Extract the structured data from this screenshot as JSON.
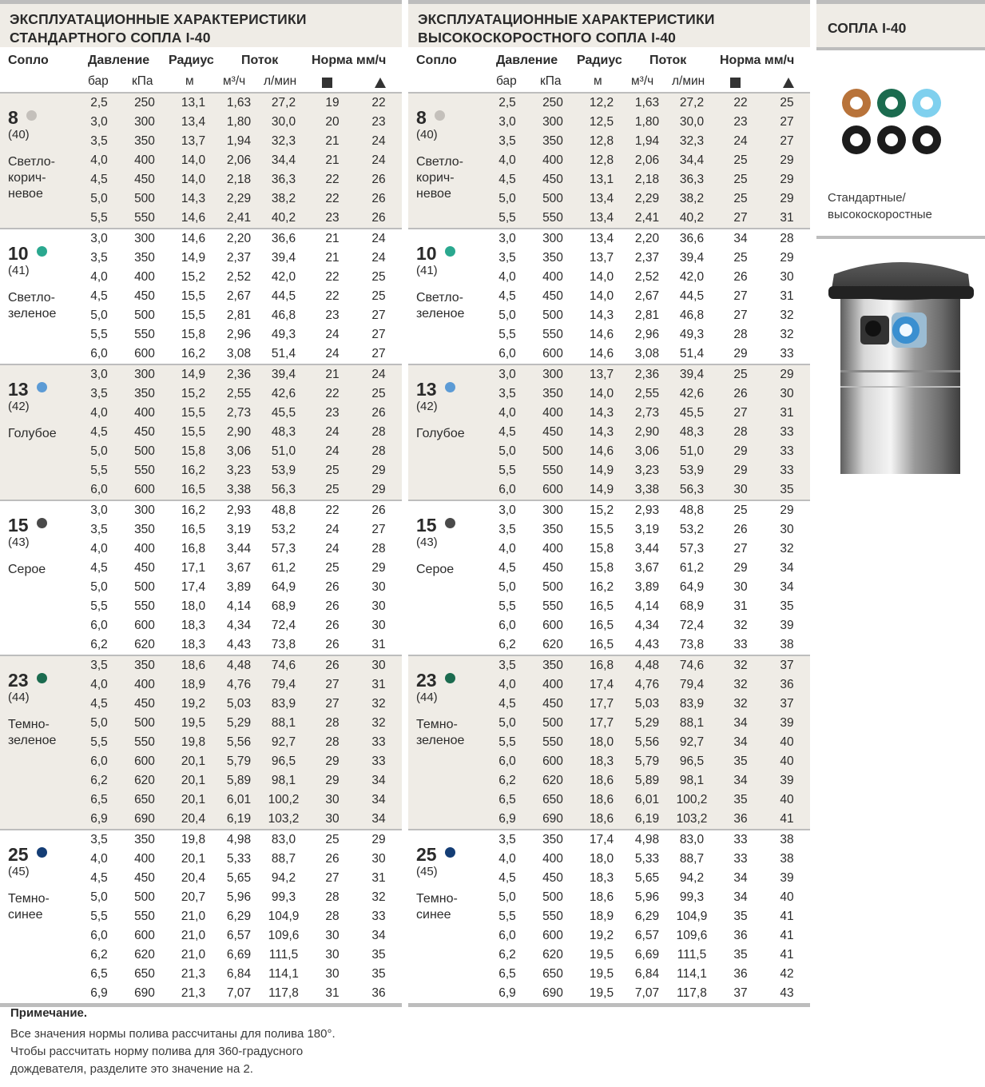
{
  "std": {
    "title_l1": "ЭКСПЛУАТАЦИОННЫЕ ХАРАКТЕРИСТИКИ",
    "title_l2": "СТАНДАРТНОГО СОПЛА I-40",
    "groups": [
      {
        "num": "8",
        "code": "(40)",
        "name1": "Светло-",
        "name2": "корич-",
        "name3": "невое",
        "color": "#c4c0bb",
        "rows": [
          [
            "2,5",
            "250",
            "13,1",
            "1,63",
            "27,2",
            "19",
            "22"
          ],
          [
            "3,0",
            "300",
            "13,4",
            "1,80",
            "30,0",
            "20",
            "23"
          ],
          [
            "3,5",
            "350",
            "13,7",
            "1,94",
            "32,3",
            "21",
            "24"
          ],
          [
            "4,0",
            "400",
            "14,0",
            "2,06",
            "34,4",
            "21",
            "24"
          ],
          [
            "4,5",
            "450",
            "14,0",
            "2,18",
            "36,3",
            "22",
            "26"
          ],
          [
            "5,0",
            "500",
            "14,3",
            "2,29",
            "38,2",
            "22",
            "26"
          ],
          [
            "5,5",
            "550",
            "14,6",
            "2,41",
            "40,2",
            "23",
            "26"
          ]
        ]
      },
      {
        "num": "10",
        "code": "(41)",
        "name1": "Светло-",
        "name2": "зеленое",
        "name3": "",
        "color": "#2aa88f",
        "rows": [
          [
            "3,0",
            "300",
            "14,6",
            "2,20",
            "36,6",
            "21",
            "24"
          ],
          [
            "3,5",
            "350",
            "14,9",
            "2,37",
            "39,4",
            "21",
            "24"
          ],
          [
            "4,0",
            "400",
            "15,2",
            "2,52",
            "42,0",
            "22",
            "25"
          ],
          [
            "4,5",
            "450",
            "15,5",
            "2,67",
            "44,5",
            "22",
            "25"
          ],
          [
            "5,0",
            "500",
            "15,5",
            "2,81",
            "46,8",
            "23",
            "27"
          ],
          [
            "5,5",
            "550",
            "15,8",
            "2,96",
            "49,3",
            "24",
            "27"
          ],
          [
            "6,0",
            "600",
            "16,2",
            "3,08",
            "51,4",
            "24",
            "27"
          ]
        ]
      },
      {
        "num": "13",
        "code": "(42)",
        "name1": "Голубое",
        "name2": "",
        "name3": "",
        "color": "#5c9bd5",
        "rows": [
          [
            "3,0",
            "300",
            "14,9",
            "2,36",
            "39,4",
            "21",
            "24"
          ],
          [
            "3,5",
            "350",
            "15,2",
            "2,55",
            "42,6",
            "22",
            "25"
          ],
          [
            "4,0",
            "400",
            "15,5",
            "2,73",
            "45,5",
            "23",
            "26"
          ],
          [
            "4,5",
            "450",
            "15,5",
            "2,90",
            "48,3",
            "24",
            "28"
          ],
          [
            "5,0",
            "500",
            "15,8",
            "3,06",
            "51,0",
            "24",
            "28"
          ],
          [
            "5,5",
            "550",
            "16,2",
            "3,23",
            "53,9",
            "25",
            "29"
          ],
          [
            "6,0",
            "600",
            "16,5",
            "3,38",
            "56,3",
            "25",
            "29"
          ]
        ]
      },
      {
        "num": "15",
        "code": "(43)",
        "name1": "Серое",
        "name2": "",
        "name3": "",
        "color": "#4a4a4a",
        "rows": [
          [
            "3,0",
            "300",
            "16,2",
            "2,93",
            "48,8",
            "22",
            "26"
          ],
          [
            "3,5",
            "350",
            "16,5",
            "3,19",
            "53,2",
            "24",
            "27"
          ],
          [
            "4,0",
            "400",
            "16,8",
            "3,44",
            "57,3",
            "24",
            "28"
          ],
          [
            "4,5",
            "450",
            "17,1",
            "3,67",
            "61,2",
            "25",
            "29"
          ],
          [
            "5,0",
            "500",
            "17,4",
            "3,89",
            "64,9",
            "26",
            "30"
          ],
          [
            "5,5",
            "550",
            "18,0",
            "4,14",
            "68,9",
            "26",
            "30"
          ],
          [
            "6,0",
            "600",
            "18,3",
            "4,34",
            "72,4",
            "26",
            "30"
          ],
          [
            "6,2",
            "620",
            "18,3",
            "4,43",
            "73,8",
            "26",
            "31"
          ]
        ]
      },
      {
        "num": "23",
        "code": "(44)",
        "name1": "Темно-",
        "name2": "зеленое",
        "name3": "",
        "color": "#1b6b4f",
        "rows": [
          [
            "3,5",
            "350",
            "18,6",
            "4,48",
            "74,6",
            "26",
            "30"
          ],
          [
            "4,0",
            "400",
            "18,9",
            "4,76",
            "79,4",
            "27",
            "31"
          ],
          [
            "4,5",
            "450",
            "19,2",
            "5,03",
            "83,9",
            "27",
            "32"
          ],
          [
            "5,0",
            "500",
            "19,5",
            "5,29",
            "88,1",
            "28",
            "32"
          ],
          [
            "5,5",
            "550",
            "19,8",
            "5,56",
            "92,7",
            "28",
            "33"
          ],
          [
            "6,0",
            "600",
            "20,1",
            "5,79",
            "96,5",
            "29",
            "33"
          ],
          [
            "6,2",
            "620",
            "20,1",
            "5,89",
            "98,1",
            "29",
            "34"
          ],
          [
            "6,5",
            "650",
            "20,1",
            "6,01",
            "100,2",
            "30",
            "34"
          ],
          [
            "6,9",
            "690",
            "20,4",
            "6,19",
            "103,2",
            "30",
            "34"
          ]
        ]
      },
      {
        "num": "25",
        "code": "(45)",
        "name1": "Темно-",
        "name2": "синее",
        "name3": "",
        "color": "#143d75",
        "rows": [
          [
            "3,5",
            "350",
            "19,8",
            "4,98",
            "83,0",
            "25",
            "29"
          ],
          [
            "4,0",
            "400",
            "20,1",
            "5,33",
            "88,7",
            "26",
            "30"
          ],
          [
            "4,5",
            "450",
            "20,4",
            "5,65",
            "94,2",
            "27",
            "31"
          ],
          [
            "5,0",
            "500",
            "20,7",
            "5,96",
            "99,3",
            "28",
            "32"
          ],
          [
            "5,5",
            "550",
            "21,0",
            "6,29",
            "104,9",
            "28",
            "33"
          ],
          [
            "6,0",
            "600",
            "21,0",
            "6,57",
            "109,6",
            "30",
            "34"
          ],
          [
            "6,2",
            "620",
            "21,0",
            "6,69",
            "111,5",
            "30",
            "35"
          ],
          [
            "6,5",
            "650",
            "21,3",
            "6,84",
            "114,1",
            "30",
            "35"
          ],
          [
            "6,9",
            "690",
            "21,3",
            "7,07",
            "117,8",
            "31",
            "36"
          ]
        ]
      }
    ]
  },
  "hs": {
    "title_l1": "ЭКСПЛУАТАЦИОННЫЕ ХАРАКТЕРИСТИКИ",
    "title_l2": "ВЫСОКОСКОРОСТНОГО СОПЛА I-40",
    "groups": [
      {
        "num": "8",
        "code": "(40)",
        "name1": "Светло-",
        "name2": "корич-",
        "name3": "невое",
        "color": "#c4c0bb",
        "rows": [
          [
            "2,5",
            "250",
            "12,2",
            "1,63",
            "27,2",
            "22",
            "25"
          ],
          [
            "3,0",
            "300",
            "12,5",
            "1,80",
            "30,0",
            "23",
            "27"
          ],
          [
            "3,5",
            "350",
            "12,8",
            "1,94",
            "32,3",
            "24",
            "27"
          ],
          [
            "4,0",
            "400",
            "12,8",
            "2,06",
            "34,4",
            "25",
            "29"
          ],
          [
            "4,5",
            "450",
            "13,1",
            "2,18",
            "36,3",
            "25",
            "29"
          ],
          [
            "5,0",
            "500",
            "13,4",
            "2,29",
            "38,2",
            "25",
            "29"
          ],
          [
            "5,5",
            "550",
            "13,4",
            "2,41",
            "40,2",
            "27",
            "31"
          ]
        ]
      },
      {
        "num": "10",
        "code": "(41)",
        "name1": "Светло-",
        "name2": "зеленое",
        "name3": "",
        "color": "#2aa88f",
        "rows": [
          [
            "3,0",
            "300",
            "13,4",
            "2,20",
            "36,6",
            "34",
            "28"
          ],
          [
            "3,5",
            "350",
            "13,7",
            "2,37",
            "39,4",
            "25",
            "29"
          ],
          [
            "4,0",
            "400",
            "14,0",
            "2,52",
            "42,0",
            "26",
            "30"
          ],
          [
            "4,5",
            "450",
            "14,0",
            "2,67",
            "44,5",
            "27",
            "31"
          ],
          [
            "5,0",
            "500",
            "14,3",
            "2,81",
            "46,8",
            "27",
            "32"
          ],
          [
            "5,5",
            "550",
            "14,6",
            "2,96",
            "49,3",
            "28",
            "32"
          ],
          [
            "6,0",
            "600",
            "14,6",
            "3,08",
            "51,4",
            "29",
            "33"
          ]
        ]
      },
      {
        "num": "13",
        "code": "(42)",
        "name1": "Голубое",
        "name2": "",
        "name3": "",
        "color": "#5c9bd5",
        "rows": [
          [
            "3,0",
            "300",
            "13,7",
            "2,36",
            "39,4",
            "25",
            "29"
          ],
          [
            "3,5",
            "350",
            "14,0",
            "2,55",
            "42,6",
            "26",
            "30"
          ],
          [
            "4,0",
            "400",
            "14,3",
            "2,73",
            "45,5",
            "27",
            "31"
          ],
          [
            "4,5",
            "450",
            "14,3",
            "2,90",
            "48,3",
            "28",
            "33"
          ],
          [
            "5,0",
            "500",
            "14,6",
            "3,06",
            "51,0",
            "29",
            "33"
          ],
          [
            "5,5",
            "550",
            "14,9",
            "3,23",
            "53,9",
            "29",
            "33"
          ],
          [
            "6,0",
            "600",
            "14,9",
            "3,38",
            "56,3",
            "30",
            "35"
          ]
        ]
      },
      {
        "num": "15",
        "code": "(43)",
        "name1": "Серое",
        "name2": "",
        "name3": "",
        "color": "#4a4a4a",
        "rows": [
          [
            "3,0",
            "300",
            "15,2",
            "2,93",
            "48,8",
            "25",
            "29"
          ],
          [
            "3,5",
            "350",
            "15,5",
            "3,19",
            "53,2",
            "26",
            "30"
          ],
          [
            "4,0",
            "400",
            "15,8",
            "3,44",
            "57,3",
            "27",
            "32"
          ],
          [
            "4,5",
            "450",
            "15,8",
            "3,67",
            "61,2",
            "29",
            "34"
          ],
          [
            "5,0",
            "500",
            "16,2",
            "3,89",
            "64,9",
            "30",
            "34"
          ],
          [
            "5,5",
            "550",
            "16,5",
            "4,14",
            "68,9",
            "31",
            "35"
          ],
          [
            "6,0",
            "600",
            "16,5",
            "4,34",
            "72,4",
            "32",
            "39"
          ],
          [
            "6,2",
            "620",
            "16,5",
            "4,43",
            "73,8",
            "33",
            "38"
          ]
        ]
      },
      {
        "num": "23",
        "code": "(44)",
        "name1": "Темно-",
        "name2": "зеленое",
        "name3": "",
        "color": "#1b6b4f",
        "rows": [
          [
            "3,5",
            "350",
            "16,8",
            "4,48",
            "74,6",
            "32",
            "37"
          ],
          [
            "4,0",
            "400",
            "17,4",
            "4,76",
            "79,4",
            "32",
            "36"
          ],
          [
            "4,5",
            "450",
            "17,7",
            "5,03",
            "83,9",
            "32",
            "37"
          ],
          [
            "5,0",
            "500",
            "17,7",
            "5,29",
            "88,1",
            "34",
            "39"
          ],
          [
            "5,5",
            "550",
            "18,0",
            "5,56",
            "92,7",
            "34",
            "40"
          ],
          [
            "6,0",
            "600",
            "18,3",
            "5,79",
            "96,5",
            "35",
            "40"
          ],
          [
            "6,2",
            "620",
            "18,6",
            "5,89",
            "98,1",
            "34",
            "39"
          ],
          [
            "6,5",
            "650",
            "18,6",
            "6,01",
            "100,2",
            "35",
            "40"
          ],
          [
            "6,9",
            "690",
            "18,6",
            "6,19",
            "103,2",
            "36",
            "41"
          ]
        ]
      },
      {
        "num": "25",
        "code": "(45)",
        "name1": "Темно-",
        "name2": "синее",
        "name3": "",
        "color": "#143d75",
        "rows": [
          [
            "3,5",
            "350",
            "17,4",
            "4,98",
            "83,0",
            "33",
            "38"
          ],
          [
            "4,0",
            "400",
            "18,0",
            "5,33",
            "88,7",
            "33",
            "38"
          ],
          [
            "4,5",
            "450",
            "18,3",
            "5,65",
            "94,2",
            "34",
            "39"
          ],
          [
            "5,0",
            "500",
            "18,6",
            "5,96",
            "99,3",
            "34",
            "40"
          ],
          [
            "5,5",
            "550",
            "18,9",
            "6,29",
            "104,9",
            "35",
            "41"
          ],
          [
            "6,0",
            "600",
            "19,2",
            "6,57",
            "109,6",
            "36",
            "41"
          ],
          [
            "6,2",
            "620",
            "19,5",
            "6,69",
            "111,5",
            "35",
            "41"
          ],
          [
            "6,5",
            "650",
            "19,5",
            "6,84",
            "114,1",
            "36",
            "42"
          ],
          [
            "6,9",
            "690",
            "19,5",
            "7,07",
            "117,8",
            "37",
            "43"
          ]
        ]
      }
    ]
  },
  "columns": {
    "nozzle": "Сопло",
    "pressure": "Давление",
    "radius": "Радиус",
    "flow": "Поток",
    "rate": "Норма мм/ч",
    "u_bar": "бар",
    "u_kpa": "кПа",
    "u_m": "м",
    "u_m3h": "м³/ч",
    "u_lmin": "л/мин",
    "square_icon": "square-icon",
    "triangle_icon": "triangle-icon"
  },
  "side": {
    "title": "СОПЛА I-40",
    "caption_l1": "Стандартные/",
    "caption_l2": "высокоскоростные",
    "nozzle_colors": [
      "#b8733a",
      "#1b6b4f",
      "#7fd0ee",
      "#1c1c1c",
      "#1c1c1c",
      "#1c1c1c"
    ]
  },
  "note": {
    "title": "Примечание.",
    "line1": "Все значения нормы полива рассчитаны для полива 180°.",
    "line2": "Чтобы рассчитать норму полива для 360-градусного",
    "line3": "дождевателя, разделите это значение на 2."
  }
}
